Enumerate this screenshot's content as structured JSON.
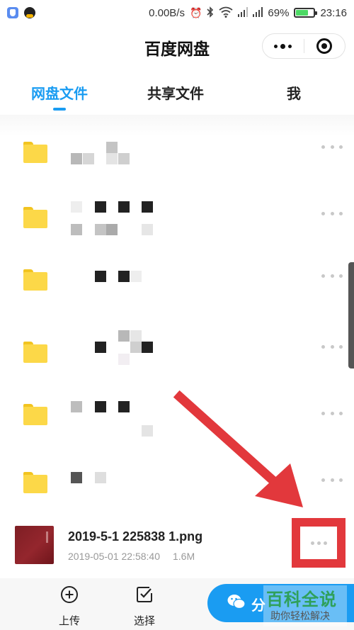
{
  "status_bar": {
    "network_speed": "0.00B/s",
    "battery_percent": "69%",
    "battery_level": 0.69,
    "time": "23:16",
    "icons": [
      "security-app-icon",
      "qq-icon",
      "alarm-icon",
      "bluetooth-icon",
      "wifi-icon",
      "signal-icon",
      "signal-icon",
      "battery-icon"
    ]
  },
  "header": {
    "title": "百度网盘",
    "icons": [
      "more-icon",
      "close-target-icon"
    ]
  },
  "tabs": [
    {
      "label": "网盘文件",
      "active": true
    },
    {
      "label": "共享文件",
      "active": false
    },
    {
      "label": "我",
      "active": false
    }
  ],
  "colors": {
    "accent": "#1a9cf2",
    "folder": "#fcd848",
    "annotation": "#e2383c",
    "watermark": "#2fa05a"
  },
  "folders": [
    {
      "name": "",
      "icon": "folder-icon"
    },
    {
      "name": "",
      "icon": "folder-icon"
    },
    {
      "name": "",
      "icon": "folder-icon"
    },
    {
      "name": "",
      "icon": "folder-icon"
    },
    {
      "name": "",
      "icon": "folder-icon"
    },
    {
      "name": "",
      "icon": "folder-icon"
    }
  ],
  "file": {
    "name": "2019-5-1 225838 1.png",
    "date": "2019-05-01 22:58:40",
    "size": "1.6M"
  },
  "bottom_bar": {
    "upload_label": "上传",
    "select_label": "选择",
    "share_label": "分"
  },
  "watermark": {
    "title": "百科全说",
    "subtitle": "助你轻松解决"
  }
}
